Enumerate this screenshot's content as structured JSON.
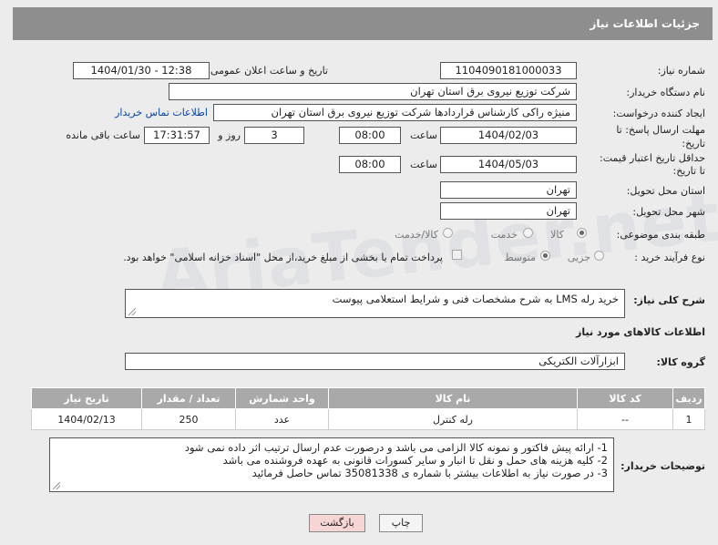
{
  "header": {
    "title": "جزئیات اطلاعات نیاز"
  },
  "fields": {
    "need_number_label": "شماره نیاز:",
    "need_number": "1104090181000033",
    "announce_label": "تاریخ و ساعت اعلان عمومی:",
    "announce_value": "1404/01/30 - 12:38",
    "buyer_org_label": "نام دستگاه خریدار:",
    "buyer_org": "شرکت توزیع نیروی برق استان تهران",
    "creator_label": "ایجاد کننده درخواست:",
    "creator": "منیژه راکی کارشناس قراردادها شرکت توزیع نیروی برق استان تهران",
    "buyer_contact_link": "اطلاعات تماس خریدار",
    "deadline_label_1": "مهلت ارسال پاسخ: تا",
    "deadline_label_2": "تاریخ:",
    "deadline_date": "1404/02/03",
    "time_label": "ساعت",
    "deadline_time": "08:00",
    "days_value": "3",
    "days_label": "روز و",
    "remaining_time": "17:31:57",
    "remaining_label": "ساعت باقی مانده",
    "price_label_1": "حداقل تاریخ اعتبار قیمت:",
    "price_label_2": "تا تاریخ:",
    "price_date": "1404/05/03",
    "price_time": "08:00",
    "province_label": "استان محل تحویل:",
    "province": "تهران",
    "city_label": "شهر محل تحویل:",
    "city": "تهران",
    "category_label": "طبقه بندی موضوعی:",
    "category_options": [
      "کالا",
      "خدمت",
      "کالا/خدمت"
    ],
    "process_label": "نوع فرآیند خرید :",
    "process_options": [
      "جزیی",
      "متوسط"
    ],
    "payment_note": "پرداخت تمام یا بخشی از مبلغ خرید،از محل \"اسناد خزانه اسلامی\" خواهد بود.",
    "description_label": "شرح کلی نیاز:",
    "description": "خرید رله LMS به شرح مشخصات فنی و شرایط استعلامی پیوست",
    "goods_section": "اطلاعات کالاهای مورد نیاز",
    "goods_group_label": "گروه کالا:",
    "goods_group": "ابزارآلات الکتریکی"
  },
  "table": {
    "headers": [
      "ردیف",
      "کد کالا",
      "نام کالا",
      "واحد شمارش",
      "تعداد / مقدار",
      "تاریخ نیاز"
    ],
    "rows": [
      [
        "1",
        "--",
        "رله کنترل",
        "عدد",
        "250",
        "1404/02/13"
      ]
    ]
  },
  "buyer_notes": {
    "label": "توضیحات خریدار:",
    "lines": [
      "1- ارائه پیش فاکتور و نمونه کالا الزامی می باشد و درصورت عدم ارسال ترتیب اثر داده نمی شود",
      "2- کلیه هزینه های حمل و نقل تا انبار و سایر کسورات قانونی به عهده فروشنده می باشد",
      "3- در صورت نیاز به اطلاعات بیشتر با شماره ی 35081338 تماس حاصل فرمائید"
    ]
  },
  "buttons": {
    "print": "چاپ",
    "back": "بازگشت"
  },
  "watermark": "AriaTender.net"
}
